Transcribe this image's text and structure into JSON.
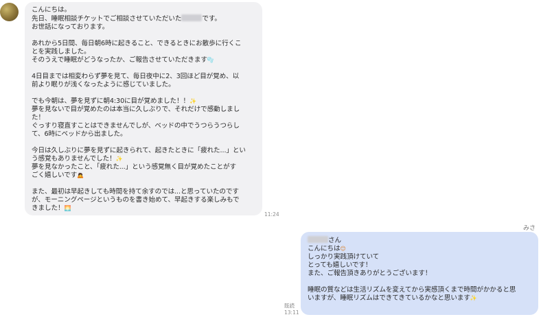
{
  "incoming": {
    "time": "11:24",
    "lines": [
      "こんにちは。",
      "先日、睡眠相談チケットでご相談させていただいた",
      "お世話になっております。",
      "",
      "あれから5日間、毎日朝6時に起きること、できるときにお散歩に行くこ",
      "とを実践しました。",
      "そのうえで睡眠がどうなったか、ご報告させていただきます",
      "",
      "4日目までは相変わらず夢を見て、毎日夜中に2、3回ほど目が覚め、以",
      "前より眠りが浅くなったように感じていました。",
      "",
      "でも今朝は、夢を見ずに朝4:30に目が覚めました！！",
      "夢を見ないで目が覚めたのは本当に久しぶりで、それだけで感動しまし",
      "た！",
      "ぐっすり寝直すことはできませんでしが、ベッドの中でうつらうつらし",
      "て、6時にベッドから出ました。",
      "",
      "今日は久しぶりに夢を見ずに起きられて、起きたときに「疲れた...」とい",
      "う感覚もありませんでした！",
      "夢を見なかったこと、「疲れた...」という感覚無く目が覚めたことがす",
      "ごく嬉しいです",
      "",
      "また、最初は早起きしても時間を持て余すのでは...と思っていたのです",
      "が、モーニングページというものを書き始めて、早起きする楽しみもで",
      "きました！"
    ],
    "line2_tail": "です。"
  },
  "outgoing": {
    "sender": "みさ",
    "read_label": "既読",
    "time": "13:11",
    "lines": [
      "さん",
      "こんにちは",
      "しっかり実践頂けていて",
      "とっても嬉しいです！",
      "また、ご報告頂きありがとうございます！",
      "",
      "睡眠の質などは生活リズムを変えてから実感頂くまで時間がかかると思",
      "いますが、睡眠リズムはできてきているかなと思います"
    ]
  },
  "emoji": {
    "bubbles": "🫧",
    "sparkle": "✨",
    "bow": "🙇",
    "sunrise": "🌅",
    "smile": "😊"
  }
}
